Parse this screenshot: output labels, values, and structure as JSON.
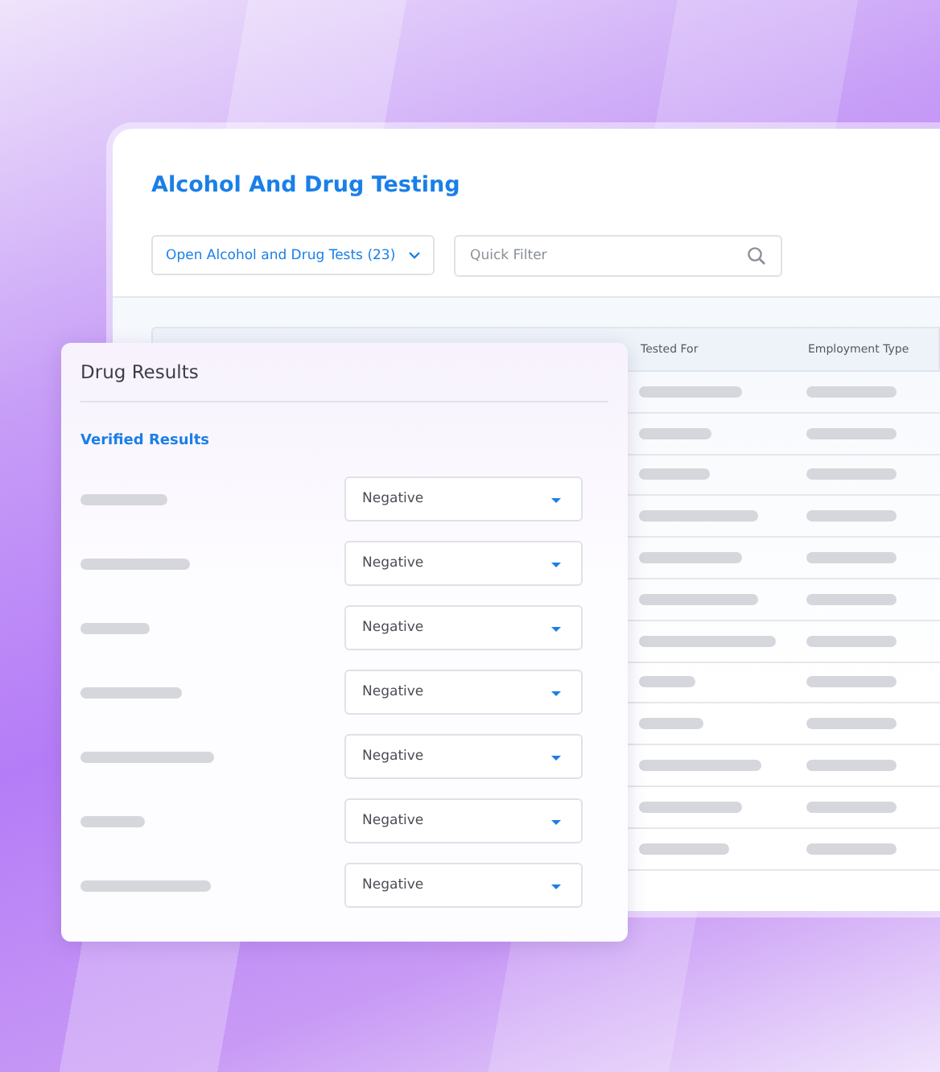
{
  "main_panel": {
    "title": "Alcohol And Drug Testing",
    "filter_dropdown": {
      "value": "Open Alcohol and Drug Tests (23)"
    },
    "quick_filter": {
      "placeholder": "Quick Filter"
    },
    "table": {
      "columns": [
        "Tested For",
        "Employment Type"
      ]
    }
  },
  "drug_results": {
    "title": "Drug Results",
    "section": "Verified Results",
    "rows": [
      {
        "value": "Negative"
      },
      {
        "value": "Negative"
      },
      {
        "value": "Negative"
      },
      {
        "value": "Negative"
      },
      {
        "value": "Negative"
      },
      {
        "value": "Negative"
      },
      {
        "value": "Negative"
      }
    ]
  }
}
